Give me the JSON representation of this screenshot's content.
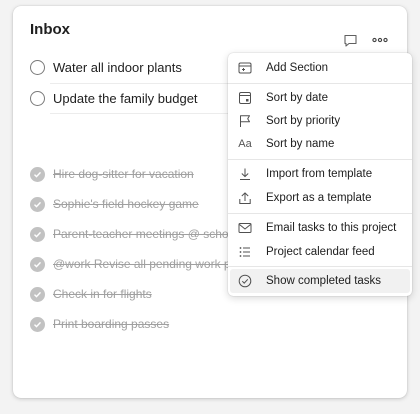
{
  "header": {
    "title": "Inbox",
    "comment_icon": "comment-icon",
    "more_icon": "more-horizontal-icon"
  },
  "tasks": [
    {
      "label": "Water all indoor plants"
    },
    {
      "label": "Update the family budget"
    }
  ],
  "completed_tasks": [
    {
      "label": "Hire dog-sitter for vacation"
    },
    {
      "label": "Sophie's field hockey game"
    },
    {
      "label": "Parent-teacher meetings @ school"
    },
    {
      "label": "@work Revise all pending work proje"
    },
    {
      "label": "Check in for flights"
    },
    {
      "label": "Print boarding passes"
    }
  ],
  "menu": {
    "items": [
      {
        "label": "Add Section",
        "icon": "add-section-icon"
      },
      {
        "label": "Sort by date",
        "icon": "calendar-icon"
      },
      {
        "label": "Sort by priority",
        "icon": "flag-icon"
      },
      {
        "label": "Sort by name",
        "icon": "text-aa-icon",
        "glyph": "Aa"
      },
      {
        "label": "Import from template",
        "icon": "download-icon"
      },
      {
        "label": "Export as a template",
        "icon": "upload-icon"
      },
      {
        "label": "Email tasks to this project",
        "icon": "mail-icon"
      },
      {
        "label": "Project calendar feed",
        "icon": "list-icon"
      },
      {
        "label": "Show completed tasks",
        "icon": "check-circle-icon"
      }
    ],
    "highlighted_index": 8
  },
  "colors": {
    "background": "#f3f3f3",
    "card": "#ffffff",
    "completed_check": "#c2c2c2",
    "completed_text": "#a0a0a0",
    "menu_highlight": "#f1f1f1"
  }
}
